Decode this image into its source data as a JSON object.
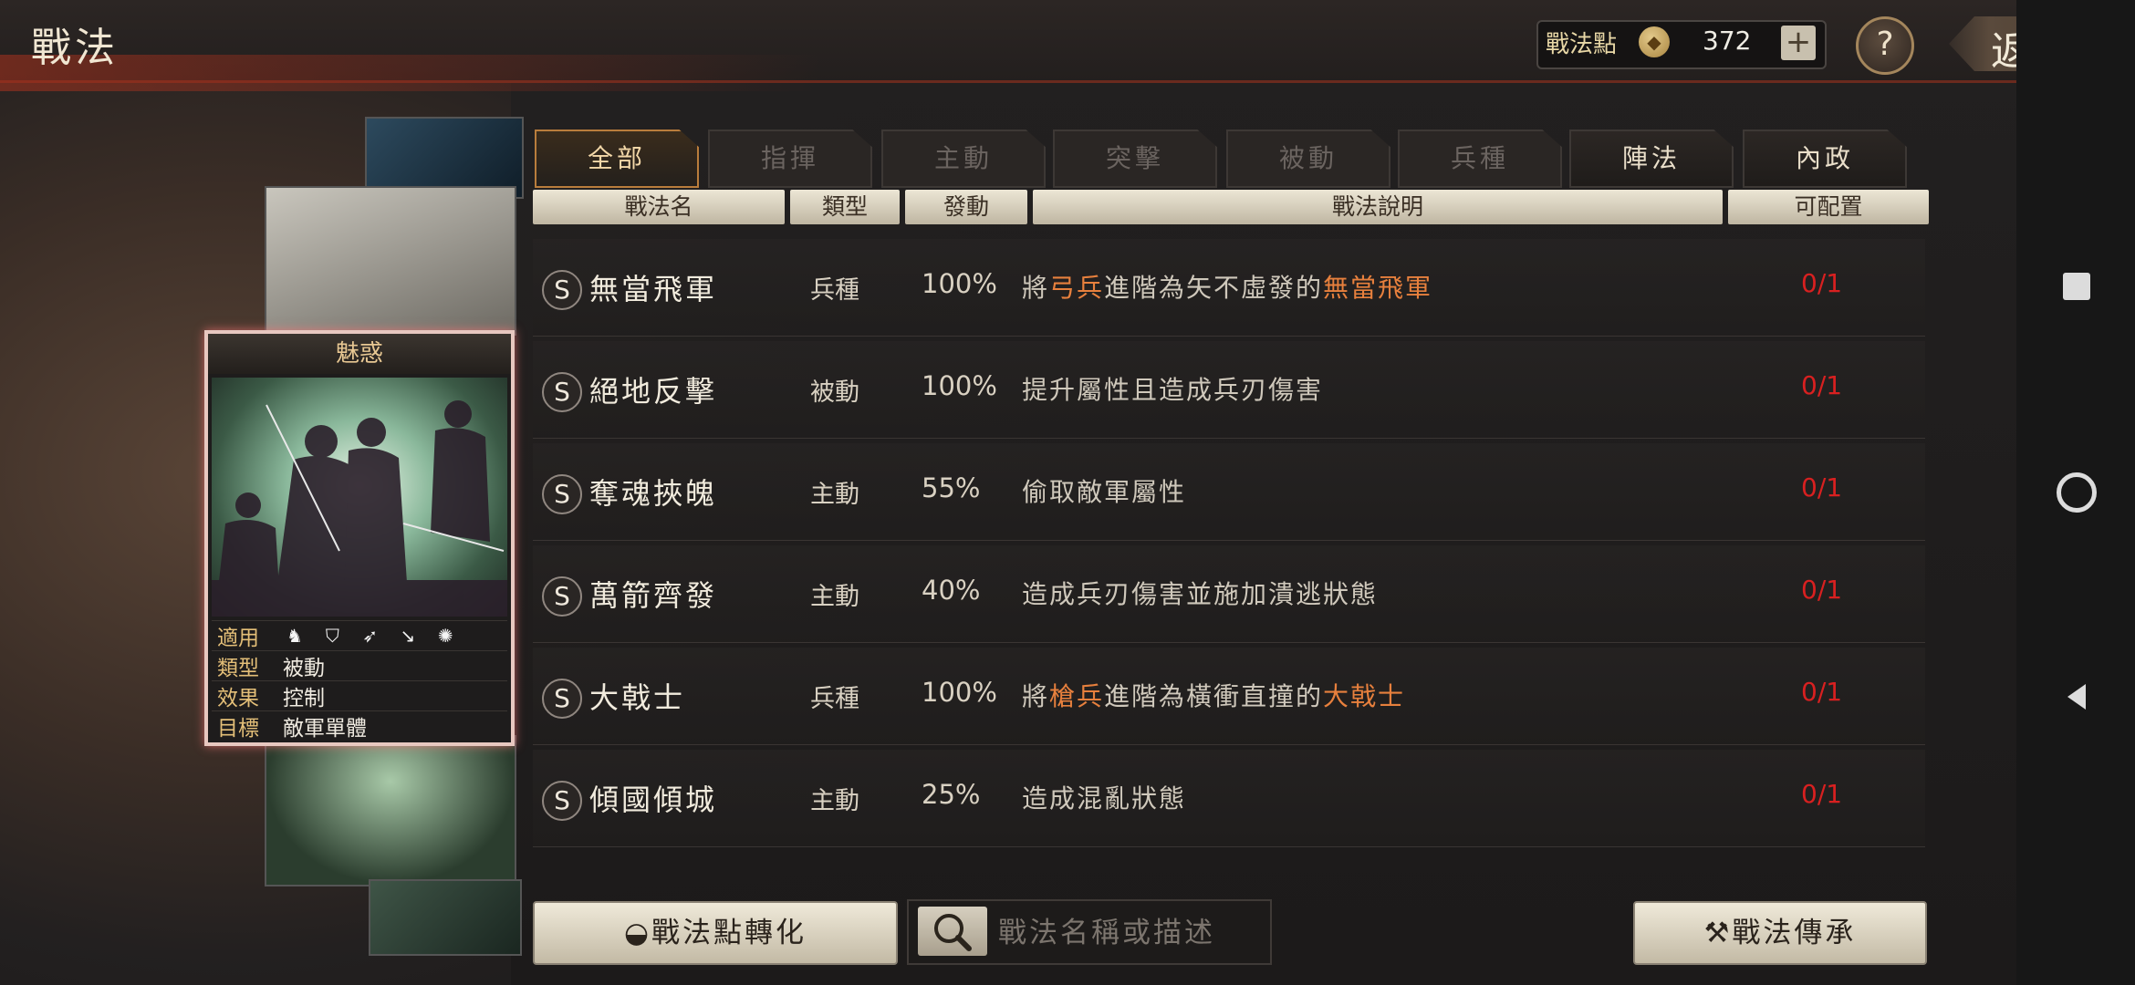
{
  "header": {
    "title": "戰法",
    "points_label": "戰法點",
    "points_value": "372",
    "plus_label": "+",
    "help_label": "?",
    "back_label": "返回"
  },
  "featured_card": {
    "name": "魅惑",
    "rows": [
      {
        "key": "適用",
        "value": ""
      },
      {
        "key": "類型",
        "value": "被動"
      },
      {
        "key": "效果",
        "value": "控制"
      },
      {
        "key": "目標",
        "value": "敵軍單體"
      }
    ],
    "applicable_icons": [
      "cavalry-icon",
      "shield-icon",
      "bow-icon",
      "spear-icon",
      "wheel-icon"
    ]
  },
  "tabs": [
    {
      "label": "全部",
      "state": "active"
    },
    {
      "label": "指揮",
      "state": "disabled"
    },
    {
      "label": "主動",
      "state": "disabled"
    },
    {
      "label": "突擊",
      "state": "disabled"
    },
    {
      "label": "被動",
      "state": "disabled"
    },
    {
      "label": "兵種",
      "state": "disabled"
    },
    {
      "label": "陣法",
      "state": "enabled"
    },
    {
      "label": "內政",
      "state": "enabled"
    }
  ],
  "columns": [
    "戰法名",
    "類型",
    "發動",
    "戰法說明",
    "可配置"
  ],
  "rows": [
    {
      "grade": "S",
      "name": "無當飛軍",
      "type": "兵種",
      "rate": "100%",
      "desc": [
        {
          "t": "將"
        },
        {
          "t": "弓兵",
          "h": true
        },
        {
          "t": "進階為矢不虛發的"
        },
        {
          "t": "無當飛軍",
          "h": true
        }
      ],
      "slot": "0/1"
    },
    {
      "grade": "S",
      "name": "絕地反擊",
      "type": "被動",
      "rate": "100%",
      "desc": [
        {
          "t": "提升屬性且造成兵刃傷害"
        }
      ],
      "slot": "0/1"
    },
    {
      "grade": "S",
      "name": "奪魂挾魄",
      "type": "主動",
      "rate": "55%",
      "desc": [
        {
          "t": "偷取敵軍屬性"
        }
      ],
      "slot": "0/1"
    },
    {
      "grade": "S",
      "name": "萬箭齊發",
      "type": "主動",
      "rate": "40%",
      "desc": [
        {
          "t": "造成兵刃傷害並施加潰逃狀態"
        }
      ],
      "slot": "0/1"
    },
    {
      "grade": "S",
      "name": "大戟士",
      "type": "兵種",
      "rate": "100%",
      "desc": [
        {
          "t": "將"
        },
        {
          "t": "槍兵",
          "h": true
        },
        {
          "t": "進階為橫衝直撞的"
        },
        {
          "t": "大戟士",
          "h": true
        }
      ],
      "slot": "0/1"
    },
    {
      "grade": "S",
      "name": "傾國傾城",
      "type": "主動",
      "rate": "25%",
      "desc": [
        {
          "t": "造成混亂狀態"
        }
      ],
      "slot": "0/1"
    }
  ],
  "bottom": {
    "convert_label": "戰法點轉化",
    "search_placeholder": "戰法名稱或描述",
    "inherit_label": "戰法傳承"
  },
  "colors": {
    "highlight": "#e7803d",
    "slot": "#d82020",
    "active_tab_border": "#b97d3c"
  }
}
